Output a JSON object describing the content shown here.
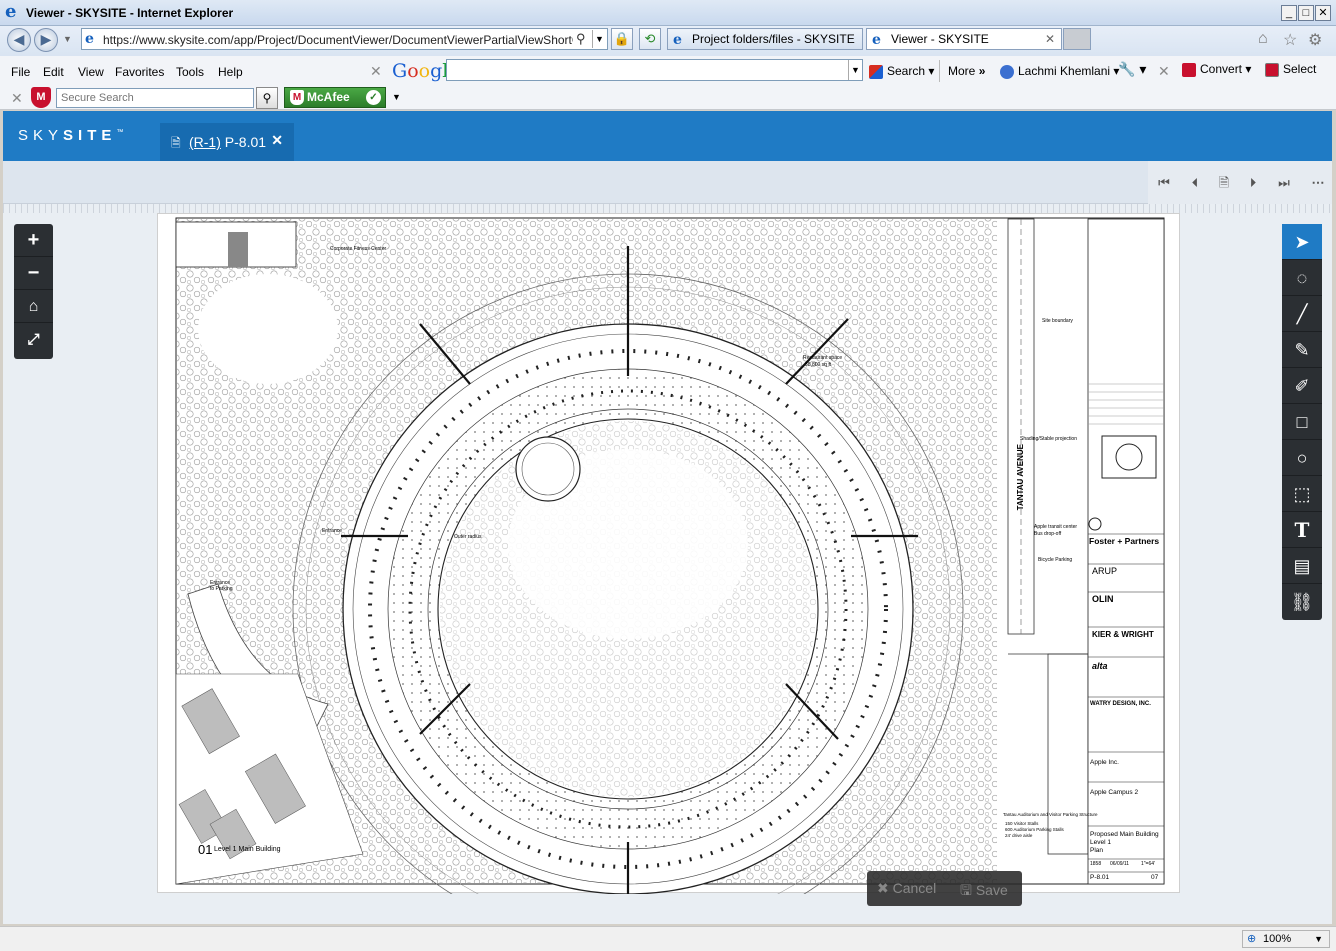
{
  "window": {
    "title": "Viewer - SKYSITE - Internet Explorer",
    "minimize": "_",
    "maximize": "□",
    "close": "✕"
  },
  "address_bar": {
    "url": "https://www.skysite.com/app/Project/DocumentViewer/DocumentViewerPartialViewShortCut?Key",
    "tabs": [
      {
        "label": "Project folders/files - SKYSITE",
        "active": false
      },
      {
        "label": "Viewer - SKYSITE",
        "active": true
      }
    ]
  },
  "menu": {
    "items": [
      "File",
      "Edit",
      "View",
      "Favorites",
      "Tools",
      "Help"
    ],
    "google_label": "Google",
    "search_label": "Search",
    "more_label": "More",
    "user_name": "Lachmi Khemlani",
    "convert_label": "Convert",
    "select_label": "Select"
  },
  "mcafee": {
    "secure_search_placeholder": "Secure Search",
    "mcafee_label": "McAfee"
  },
  "app": {
    "brand_light": "SKY",
    "brand_bold": "SITE",
    "brand_tm": "™",
    "doc_tab": {
      "revision": "(R-1)",
      "sheet": "P-8.01"
    }
  },
  "drawing": {
    "title_block": {
      "architect": "Foster + Partners",
      "engineer": "ARUP",
      "landscape": "OLIN",
      "contractor": "KIER & WRIGHT",
      "alta": "alta",
      "watry": "WATRY DESIGN, INC.",
      "client": "Apple Inc.",
      "project": "Apple Campus 2",
      "drawing_title_1": "Proposed Main Building",
      "drawing_title_2": "Level 1",
      "drawing_title_3": "Plan",
      "job_no": "1858",
      "date": "06/09/11",
      "scale": "1\"=64'",
      "sheet_no": "P-8.01",
      "rev": "07"
    },
    "labels": {
      "street": "TANTAU AVENUE",
      "plan_number": "01",
      "plan_label": "Level 1 Main Building",
      "corporate": "Corporate Fitness Center",
      "restaurant": "Restaurant space",
      "restaurant_area": "58,800 sq ft",
      "site_boundary": "Site boundary",
      "entrance": "Entrance",
      "entrance_parking": "Entrance",
      "entrance_parking_2": "to Parking",
      "shading": "Shading/Stable projection",
      "apple_transit": "Apple transit center",
      "bus_dropoff": "Bus drop-off",
      "bicycle": "Bicycle Parking",
      "parking_structure": "Tantau Auditorium and Visitor Parking Structure",
      "outer_radius": "Outer radius",
      "visitor": "150 Visitor Stalls",
      "aud_parking": "600 Auditorium Parking Stalls",
      "ev": "24' drive aisle"
    }
  },
  "actions": {
    "cancel": "Cancel",
    "save": "Save"
  },
  "status": {
    "zoom": "100%"
  },
  "colors": {
    "brand_blue": "#1f7bc5",
    "toolbar_dark": "#2b2f33"
  }
}
